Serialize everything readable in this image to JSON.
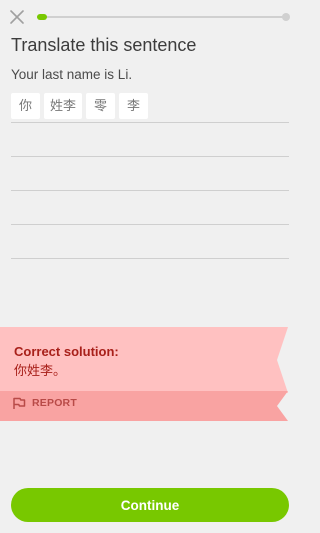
{
  "header": {
    "close_icon": "close-icon",
    "progress": 0.04,
    "progress_color": "#78c800"
  },
  "exercise": {
    "title": "Translate this sentence",
    "source_sentence": "Your last name is Li.",
    "word_bank": [
      "你",
      "姓李",
      "零",
      "李"
    ]
  },
  "feedback": {
    "heading": "Correct solution:",
    "solution": "你姓李。",
    "report_label": "REPORT",
    "report_icon": "flag-icon",
    "background_color": "#ffc1c1",
    "text_color": "#a8201a"
  },
  "footer": {
    "continue_label": "Continue",
    "button_color": "#78c800"
  }
}
